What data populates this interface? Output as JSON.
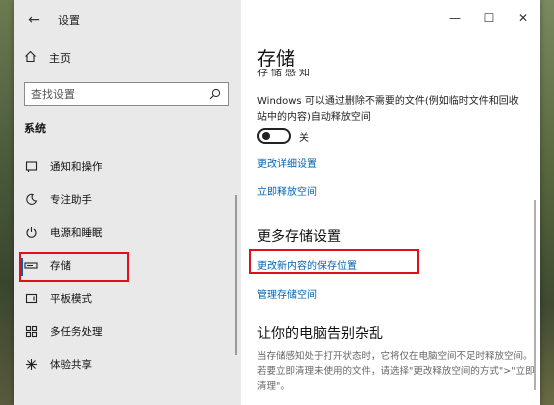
{
  "window": {
    "title": "设置",
    "back_glyph": "←",
    "controls": {
      "minimize": "—",
      "maximize": "☐",
      "close": "✕"
    }
  },
  "sidebar": {
    "home_label": "主页",
    "search_placeholder": "查找设置",
    "section_label": "系统",
    "items": [
      {
        "label": "通知和操作",
        "icon": "notification-icon"
      },
      {
        "label": "专注助手",
        "icon": "moon-icon"
      },
      {
        "label": "电源和睡眠",
        "icon": "power-icon"
      },
      {
        "label": "存储",
        "icon": "storage-icon",
        "selected": true
      },
      {
        "label": "平板模式",
        "icon": "tablet-icon"
      },
      {
        "label": "多任务处理",
        "icon": "multitask-icon"
      },
      {
        "label": "体验共享",
        "icon": "share-icon"
      }
    ]
  },
  "content": {
    "title": "存储",
    "cut_heading": "存储感知",
    "description": "Windows 可以通过删除不需要的文件(例如临时文件和回收站中的内容)自动释放空间",
    "toggle_state": "关",
    "link_change_details": "更改详细设置",
    "link_free_now": "立即释放空间",
    "more_settings_title": "更多存储设置",
    "link_change_save_location": "更改新内容的保存位置",
    "link_manage_spaces": "管理存储空间",
    "clutter_title": "让你的电脑告别杂乱",
    "clutter_desc": "当存储感知处于打开状态时，它将仅在电脑空间不足时释放空间。若要立即清理未使用的文件，请选择\"更改释放空间的方式\">\"立即清理\"。"
  },
  "colors": {
    "accent": "#0063b1",
    "annotation": "#e0101a",
    "sidebar_bg": "#e9e9e9"
  }
}
